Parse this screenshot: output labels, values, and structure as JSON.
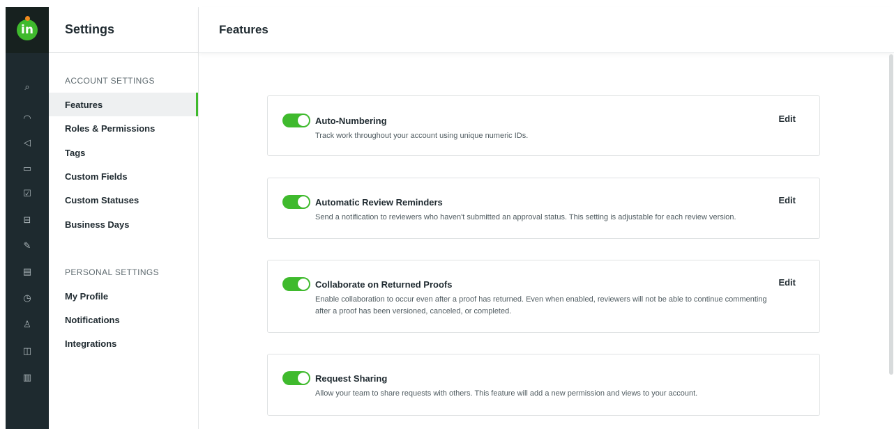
{
  "rail": {
    "logo_text": "in",
    "icons": [
      "search-icon",
      "dashboard-icon",
      "megaphone-icon",
      "folder-icon",
      "checkbox-icon",
      "inbox-icon",
      "proof-icon",
      "calendar-icon",
      "clock-icon",
      "user-icon",
      "layout-icon",
      "chart-icon"
    ],
    "glyphs": [
      "⌕",
      "◠",
      "◁",
      "▭",
      "☑",
      "⊟",
      "✎",
      "▤",
      "◷",
      "♙",
      "◫",
      "▥"
    ]
  },
  "nav": {
    "title": "Settings",
    "account_section": "ACCOUNT SETTINGS",
    "account_items": [
      "Features",
      "Roles & Permissions",
      "Tags",
      "Custom Fields",
      "Custom Statuses",
      "Business Days"
    ],
    "personal_section": "PERSONAL SETTINGS",
    "personal_items": [
      "My Profile",
      "Notifications",
      "Integrations"
    ],
    "active_item": "Features"
  },
  "main": {
    "title": "Features",
    "features": [
      {
        "title": "Auto-Numbering",
        "desc": "Track work throughout your account using unique numeric IDs.",
        "edit": "Edit",
        "enabled": true
      },
      {
        "title": "Automatic Review Reminders",
        "desc": "Send a notification to reviewers who haven't submitted an approval status. This setting is adjustable for each review version.",
        "edit": "Edit",
        "enabled": true
      },
      {
        "title": "Collaborate on Returned Proofs",
        "desc": "Enable collaboration to occur even after a proof has returned. Even when enabled, reviewers will not be able to continue commenting after a proof has been versioned, canceled, or completed.",
        "edit": "Edit",
        "enabled": true
      },
      {
        "title": "Request Sharing",
        "desc": "Allow your team to share requests with others. This feature will add a new permission and views to your account.",
        "edit": "",
        "enabled": true
      }
    ]
  },
  "colors": {
    "accent": "#3fba2d",
    "rail": "#1e2a2f",
    "logo_dot": "#f28a1e"
  }
}
